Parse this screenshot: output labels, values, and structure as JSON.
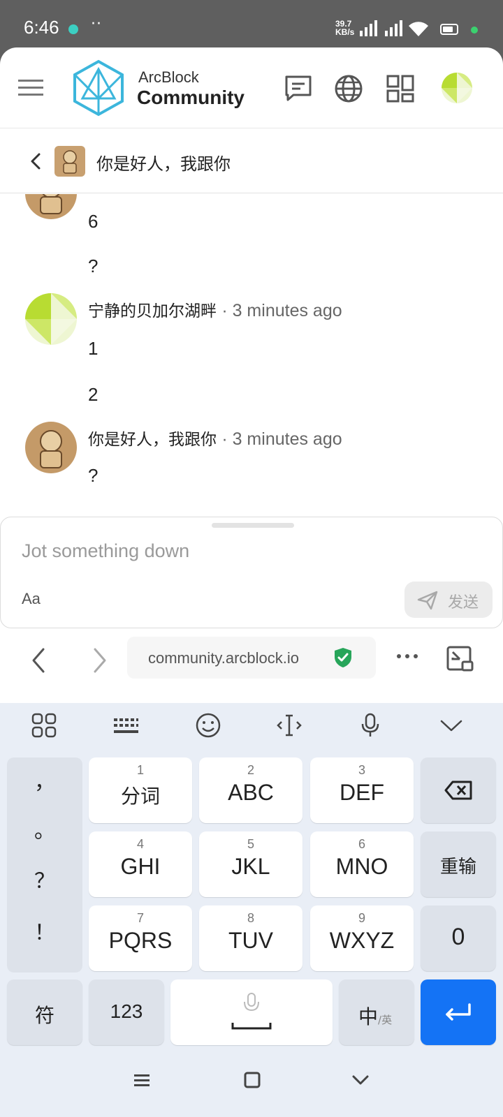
{
  "status_bar": {
    "time": "6:46",
    "more": "··",
    "net_speed_value": "39.7",
    "net_speed_unit": "KB/s"
  },
  "header": {
    "brand_top": "ArcBlock",
    "brand_bottom": "Community",
    "icons": [
      "menu-icon",
      "chat-icon",
      "globe-icon",
      "apps-icon",
      "user-avatar"
    ]
  },
  "chat": {
    "title": "你是好人，我跟你"
  },
  "messages": [
    {
      "lines": [
        "6",
        "?"
      ]
    },
    {
      "author": "宁静的贝加尔湖畔",
      "time": "· 3 minutes ago",
      "lines": [
        "1",
        "2"
      ]
    },
    {
      "author": "你是好人，我跟你",
      "time": "· 3 minutes ago",
      "lines": [
        "?"
      ]
    }
  ],
  "composer": {
    "placeholder": "Jot something down",
    "font_toggle": "Aa",
    "send_label": "发送"
  },
  "browser": {
    "url": "community.arcblock.io",
    "more": "···"
  },
  "keyboard": {
    "punctuation": [
      "，",
      "。",
      "？",
      "！"
    ],
    "rows": [
      [
        {
          "num": "1",
          "label": "分词"
        },
        {
          "num": "2",
          "label": "ABC"
        },
        {
          "num": "3",
          "label": "DEF"
        }
      ],
      [
        {
          "num": "4",
          "label": "GHI"
        },
        {
          "num": "5",
          "label": "JKL"
        },
        {
          "num": "6",
          "label": "MNO"
        }
      ],
      [
        {
          "num": "7",
          "label": "PQRS"
        },
        {
          "num": "8",
          "label": "TUV"
        },
        {
          "num": "9",
          "label": "WXYZ"
        }
      ]
    ],
    "side_keys": {
      "reinput": "重输",
      "zero": "0"
    },
    "bottom": {
      "symbols": "符",
      "numbers": "123",
      "lang_main": "中",
      "lang_sub": "/英"
    }
  },
  "colors": {
    "status_bg": "#5f5f5f",
    "accent_blue": "#1473f5",
    "shield_green": "#27a55a",
    "keyboard_bg": "#e9eef6"
  }
}
